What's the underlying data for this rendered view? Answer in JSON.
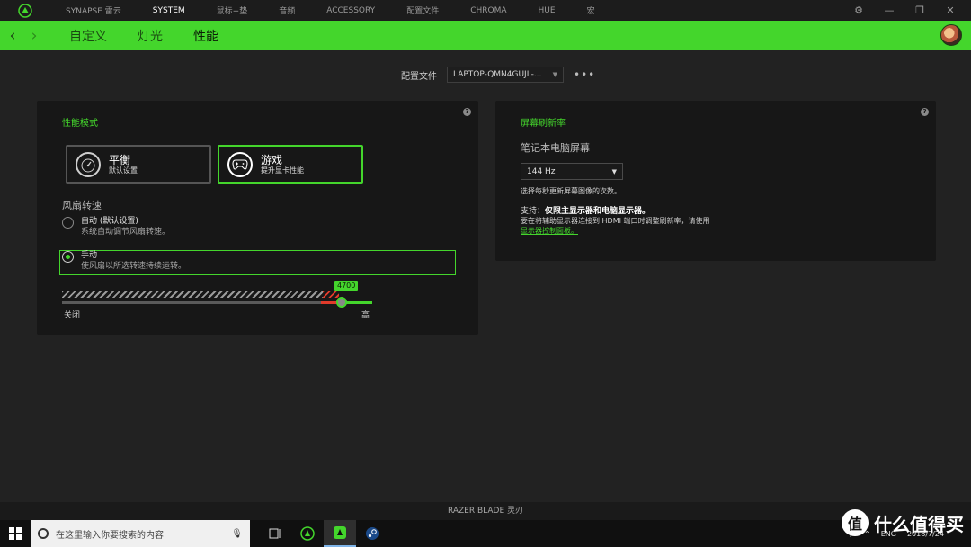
{
  "nav": {
    "items": [
      "SYNAPSE 雷云",
      "SYSTEM",
      "鼠标+垫",
      "音频",
      "ACCESSORY",
      "配置文件",
      "CHROMA",
      "HUE",
      "宏"
    ],
    "active_index": 1
  },
  "window_controls": [
    "gear-icon",
    "minimize-icon",
    "maximize-icon",
    "close-icon"
  ],
  "sub_nav": {
    "tabs": [
      "自定义",
      "灯光",
      "性能"
    ],
    "active_index": 2
  },
  "profile": {
    "label": "配置文件",
    "value": "LAPTOP-QMN4GUJL-...",
    "more": "•••"
  },
  "performance": {
    "title": "性能模式",
    "modes": [
      {
        "name": "平衡",
        "desc": "默认设置",
        "icon": "speedometer-icon",
        "selected": false
      },
      {
        "name": "游戏",
        "desc": "提升显卡性能",
        "icon": "gamepad-icon",
        "selected": true
      }
    ],
    "fan_label": "风扇转速",
    "fan_options": [
      {
        "title": "自动 (默认设置)",
        "desc": "系统自动调节风扇转速。",
        "selected": false
      },
      {
        "title": "手动",
        "desc": "使风扇以所选转速持续运转。",
        "selected": true
      }
    ],
    "fan_slider": {
      "value": "4700",
      "fraction": 0.9,
      "min_label": "关闭",
      "max_label": "高"
    }
  },
  "refresh_rate": {
    "title": "屏幕刷新率",
    "screen_label": "笔记本电脑屏幕",
    "value": "144 Hz",
    "hint": "选择每秒更新屏幕图像的次数。",
    "support_prefix": "支持：",
    "support_value": "仅限主显示器和电脑显示器。",
    "note": "要在将辅助显示器连接到 HDMI 端口时调整刷新率，请使用",
    "link": "显示器控制面板。"
  },
  "device": "RAZER BLADE 灵刃",
  "taskbar": {
    "search_placeholder": "在这里输入你要搜索的内容",
    "tray": {
      "lang": "ENG",
      "date": "2018/7/24"
    }
  },
  "watermark": {
    "badge": "值",
    "text": "什么值得买"
  },
  "colors": {
    "accent": "#44d62c",
    "background": "#222222",
    "panel": "#171717"
  }
}
